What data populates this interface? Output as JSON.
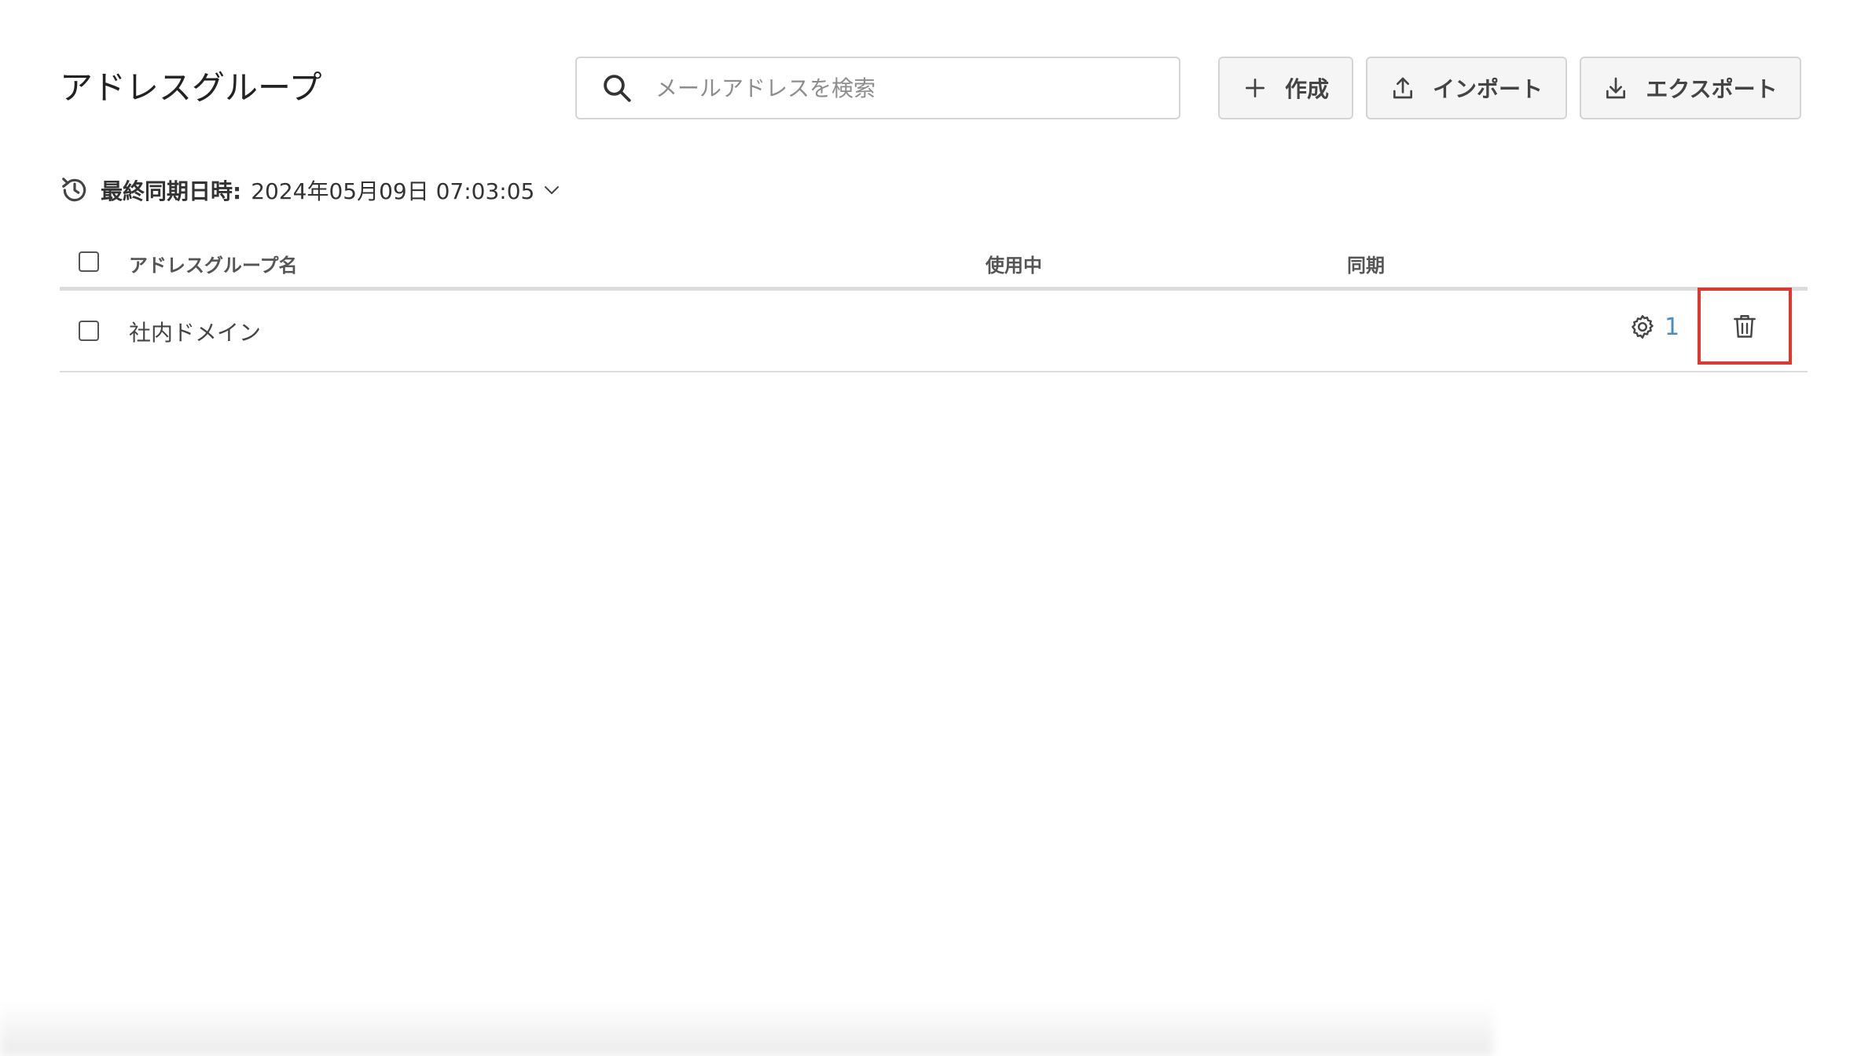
{
  "page": {
    "title": "アドレスグループ"
  },
  "search": {
    "placeholder": "メールアドレスを検索",
    "icon": "search-icon"
  },
  "toolbar": {
    "create_label": "作成",
    "import_label": "インポート",
    "export_label": "エクスポート",
    "create_icon": "plus-icon",
    "import_icon": "upload-icon",
    "export_icon": "download-icon"
  },
  "sync": {
    "label": "最終同期日時:",
    "value": "2024年05月09日 07:03:05",
    "icon": "sync-history-icon"
  },
  "table": {
    "columns": [
      "アドレスグループ名",
      "使用中",
      "同期"
    ],
    "rows": [
      {
        "name": "社内ドメイン",
        "in_use_count": "1"
      }
    ]
  },
  "colors": {
    "accent_link": "#4a8bc8",
    "highlight_border": "#e2362c"
  }
}
